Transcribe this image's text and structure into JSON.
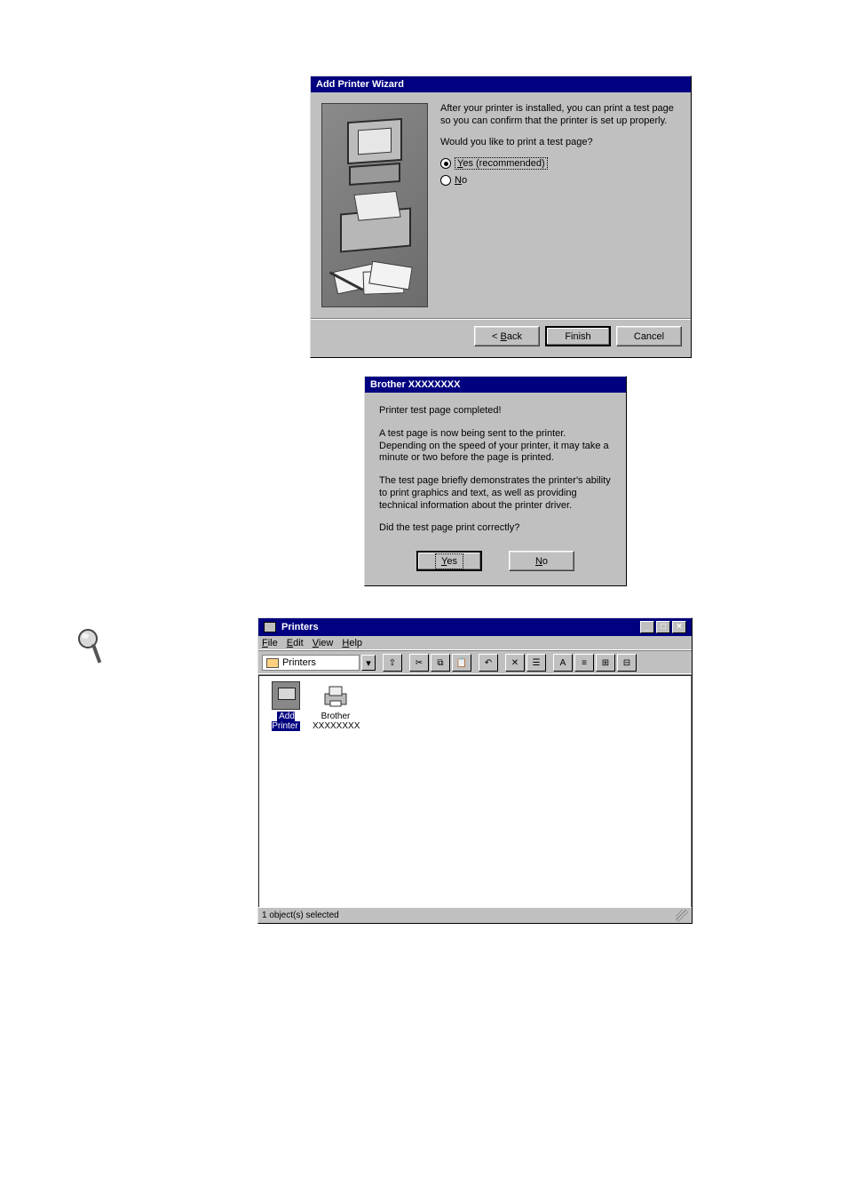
{
  "wizard": {
    "title": "Add Printer Wizard",
    "text1": "After your printer is installed, you can print a test page so you can confirm that the printer is set up properly.",
    "text2": "Would you like to print a test page?",
    "radio_yes_prefix": "Y",
    "radio_yes_rest": "es (recommended)",
    "radio_no_prefix": "N",
    "radio_no_rest": "o",
    "back_prefix": "< ",
    "back_ul": "B",
    "back_rest": "ack",
    "finish": "Finish",
    "cancel": "Cancel"
  },
  "testdlg": {
    "title_brand": "Brother",
    "title_model": " XXXXXXXX",
    "p1": "Printer test page completed!",
    "p2": "A test page is now being sent to the printer. Depending on the speed of your printer, it may take a minute or two before the page is printed.",
    "p3": "The test page briefly demonstrates the printer's ability to print graphics and text, as well as providing technical information about the printer driver.",
    "p4": "Did the test page print correctly?",
    "yes_ul": "Y",
    "yes_rest": "es",
    "no_ul": "N",
    "no_rest": "o"
  },
  "printers": {
    "title": "Printers",
    "menu": {
      "file_ul": "F",
      "file_rest": "ile",
      "edit_ul": "E",
      "edit_rest": "dit",
      "view_ul": "V",
      "view_rest": "iew",
      "help_ul": "H",
      "help_rest": "elp"
    },
    "address_label": "Printers",
    "toolbar_glyphs": {
      "up": "⇧",
      "cut": "✂",
      "copy": "⧉",
      "paste": "📋",
      "undo": "↶",
      "delete": "✕",
      "properties": "☰",
      "views1": "A",
      "views2": "≡",
      "views3": "⊞",
      "views4": "⊟"
    },
    "items": [
      {
        "label": "Add Printer",
        "selected": true
      },
      {
        "label_line1": "Brother",
        "label_line2": "XXXXXXXX",
        "selected": false
      }
    ],
    "status": "1 object(s) selected",
    "winctrls": {
      "min": "_",
      "max": "□",
      "close": "×"
    }
  }
}
